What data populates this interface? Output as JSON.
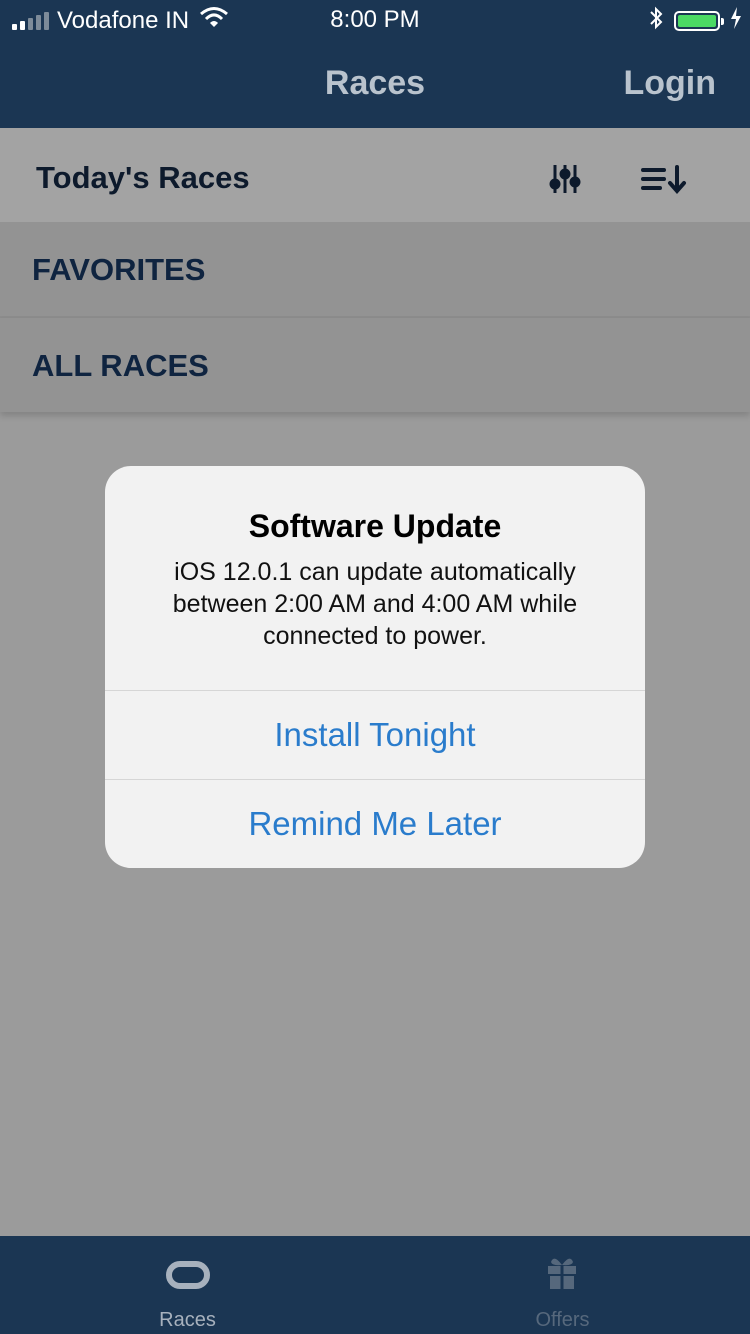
{
  "status": {
    "carrier": "Vodafone IN",
    "time": "8:00 PM"
  },
  "nav": {
    "title": "Races",
    "login": "Login"
  },
  "header": {
    "title": "Today's Races"
  },
  "sections": {
    "favorites": "FAVORITES",
    "all_races": "ALL RACES"
  },
  "alert": {
    "title": "Software Update",
    "message": "iOS 12.0.1 can update automatically between 2:00 AM and 4:00 AM while connected to power.",
    "install": "Install Tonight",
    "remind": "Remind Me Later"
  },
  "tabs": {
    "races": "Races",
    "offers": "Offers"
  },
  "colors": {
    "nav": "#1b3653",
    "alert_button": "#2a7ccc",
    "battery": "#4cd964"
  },
  "icons": [
    "signal-icon",
    "wifi-icon",
    "bluetooth-icon",
    "battery-icon",
    "charging-icon",
    "filter-sliders-icon",
    "sort-icon",
    "races-tab-icon",
    "gift-icon"
  ]
}
